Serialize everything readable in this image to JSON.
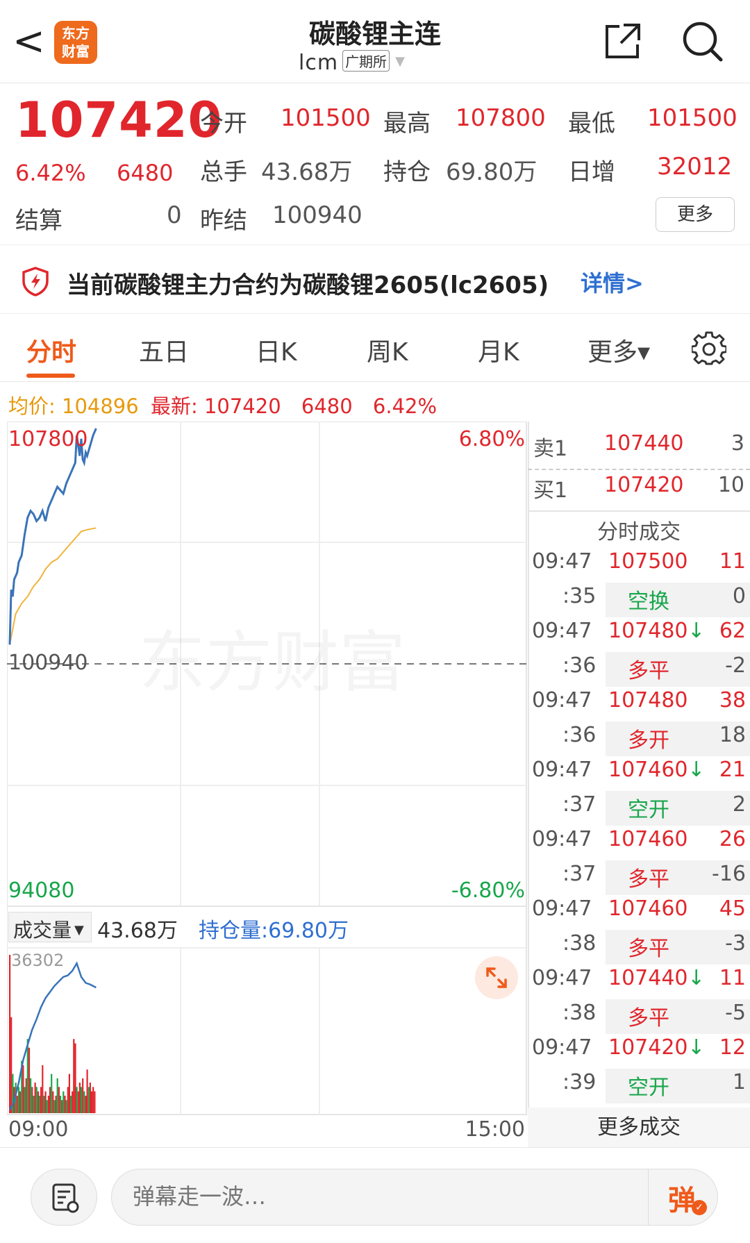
{
  "header": {
    "back": "<",
    "logo_line1": "东方",
    "logo_line2": "财富",
    "title": "碳酸锂主连",
    "code": "lcm",
    "exchange": "广期所"
  },
  "quote": {
    "price": "107420",
    "pct": "6.42%",
    "change": "6480",
    "open_label": "今开",
    "open": "101500",
    "high_label": "最高",
    "high": "107800",
    "low_label": "最低",
    "low": "101500",
    "volume_label": "总手",
    "volume": "43.68万",
    "oi_label": "持仓",
    "oi": "69.80万",
    "daily_inc_label": "日增",
    "daily_inc": "32012",
    "settle_label": "结算",
    "settle": "0",
    "prev_settle_label": "昨结",
    "prev_settle": "100940",
    "more_label": "更多"
  },
  "notice": {
    "text": "当前碳酸锂主力合约为碳酸锂2605(lc2605)",
    "link": "详情>"
  },
  "tabs": [
    "分时",
    "五日",
    "日K",
    "周K",
    "月K",
    "更多▾"
  ],
  "info": {
    "avg_label": "均价:",
    "avg": "104896",
    "latest_label": "最新:",
    "latest": "107420",
    "change": "6480",
    "pct": "6.42%"
  },
  "chart_data": {
    "type": "line",
    "y_top": "107800",
    "y_bottom": "94080",
    "y_ref": "100940",
    "pct_top": "6.80%",
    "pct_bottom": "-6.80%",
    "ylim": [
      94080,
      107800
    ],
    "ref_price": 100940,
    "x_start_label": "09:00",
    "x_end_label": "15:00",
    "total_minutes": 345,
    "price_series": [
      [
        0,
        101500
      ],
      [
        1,
        103100
      ],
      [
        2,
        102900
      ],
      [
        3,
        103400
      ],
      [
        4,
        103500
      ],
      [
        5,
        103600
      ],
      [
        6,
        103900
      ],
      [
        8,
        104100
      ],
      [
        10,
        104700
      ],
      [
        12,
        105200
      ],
      [
        14,
        105400
      ],
      [
        16,
        105300
      ],
      [
        18,
        105100
      ],
      [
        20,
        105200
      ],
      [
        22,
        105400
      ],
      [
        24,
        105100
      ],
      [
        26,
        105500
      ],
      [
        28,
        105700
      ],
      [
        30,
        105900
      ],
      [
        32,
        106100
      ],
      [
        34,
        106000
      ],
      [
        36,
        105900
      ],
      [
        38,
        106200
      ],
      [
        40,
        106400
      ],
      [
        42,
        106600
      ],
      [
        44,
        106800
      ],
      [
        45,
        107600
      ],
      [
        46,
        107300
      ],
      [
        47,
        107000
      ],
      [
        48,
        107500
      ],
      [
        49,
        106900
      ],
      [
        50,
        106800
      ],
      [
        51,
        107100
      ],
      [
        52,
        107000
      ],
      [
        54,
        107300
      ],
      [
        56,
        107600
      ],
      [
        58,
        107800
      ]
    ],
    "avg_series": [
      [
        0,
        101500
      ],
      [
        4,
        102400
      ],
      [
        8,
        102700
      ],
      [
        12,
        102900
      ],
      [
        16,
        103200
      ],
      [
        20,
        103400
      ],
      [
        24,
        103700
      ],
      [
        28,
        103900
      ],
      [
        32,
        104000
      ],
      [
        36,
        104200
      ],
      [
        40,
        104400
      ],
      [
        44,
        104600
      ],
      [
        48,
        104800
      ],
      [
        52,
        104850
      ],
      [
        58,
        104900
      ]
    ],
    "volume": {
      "label": "成交量",
      "value": "43.68万",
      "oi_label": "持仓量:69.80万",
      "max_label": "36302",
      "max": 36302,
      "bars": [
        [
          0,
          36302,
          "red"
        ],
        [
          1,
          22000,
          "red"
        ],
        [
          2,
          9000,
          "green"
        ],
        [
          3,
          6000,
          "red"
        ],
        [
          4,
          7000,
          "green"
        ],
        [
          5,
          4000,
          "red"
        ],
        [
          6,
          6000,
          "green"
        ],
        [
          7,
          5000,
          "red"
        ],
        [
          8,
          12000,
          "green"
        ],
        [
          9,
          11000,
          "red"
        ],
        [
          10,
          6000,
          "green"
        ],
        [
          11,
          8000,
          "red"
        ],
        [
          12,
          17000,
          "green"
        ],
        [
          13,
          15000,
          "red"
        ],
        [
          14,
          8000,
          "green"
        ],
        [
          15,
          6000,
          "red"
        ],
        [
          16,
          4000,
          "green"
        ],
        [
          17,
          7000,
          "red"
        ],
        [
          18,
          6000,
          "green"
        ],
        [
          19,
          5000,
          "red"
        ],
        [
          20,
          4000,
          "green"
        ],
        [
          21,
          6000,
          "red"
        ],
        [
          22,
          11000,
          "red"
        ],
        [
          23,
          4000,
          "green"
        ],
        [
          24,
          5000,
          "red"
        ],
        [
          25,
          3000,
          "green"
        ],
        [
          26,
          4000,
          "red"
        ],
        [
          27,
          6000,
          "red"
        ],
        [
          28,
          9000,
          "green"
        ],
        [
          29,
          5000,
          "red"
        ],
        [
          30,
          3000,
          "green"
        ],
        [
          31,
          4000,
          "red"
        ],
        [
          32,
          8000,
          "green"
        ],
        [
          33,
          6000,
          "red"
        ],
        [
          34,
          4000,
          "green"
        ],
        [
          35,
          3000,
          "red"
        ],
        [
          36,
          5000,
          "green"
        ],
        [
          37,
          4000,
          "red"
        ],
        [
          38,
          3000,
          "green"
        ],
        [
          39,
          6000,
          "red"
        ],
        [
          40,
          9000,
          "red"
        ],
        [
          41,
          4000,
          "green"
        ],
        [
          42,
          5000,
          "red"
        ],
        [
          43,
          17000,
          "red"
        ],
        [
          44,
          16000,
          "red"
        ],
        [
          45,
          6000,
          "green"
        ],
        [
          46,
          5000,
          "red"
        ],
        [
          47,
          7000,
          "red"
        ],
        [
          48,
          6000,
          "green"
        ],
        [
          49,
          8000,
          "red"
        ],
        [
          50,
          5000,
          "green"
        ],
        [
          51,
          4000,
          "red"
        ],
        [
          52,
          10000,
          "red"
        ],
        [
          53,
          6000,
          "green"
        ],
        [
          54,
          7000,
          "red"
        ],
        [
          55,
          5000,
          "red"
        ],
        [
          56,
          6000,
          "red"
        ],
        [
          57,
          5000,
          "red"
        ]
      ],
      "oi_line": [
        [
          0,
          0.02
        ],
        [
          3,
          0.08
        ],
        [
          6,
          0.2
        ],
        [
          9,
          0.35
        ],
        [
          12,
          0.45
        ],
        [
          15,
          0.55
        ],
        [
          18,
          0.62
        ],
        [
          21,
          0.7
        ],
        [
          24,
          0.76
        ],
        [
          27,
          0.8
        ],
        [
          30,
          0.84
        ],
        [
          33,
          0.87
        ],
        [
          36,
          0.9
        ],
        [
          39,
          0.91
        ],
        [
          42,
          0.94
        ],
        [
          45,
          0.99
        ],
        [
          48,
          0.9
        ],
        [
          51,
          0.86
        ],
        [
          54,
          0.85
        ],
        [
          58,
          0.83
        ]
      ]
    }
  },
  "book": {
    "sell_label": "卖1",
    "sell_price": "107440",
    "sell_vol": "3",
    "buy_label": "买1",
    "buy_price": "107420",
    "buy_vol": "10",
    "trades_title": "分时成交",
    "trades": [
      {
        "time": "09:47",
        "price": "107500",
        "arrow": "",
        "vol": "11",
        "sec": ":35",
        "type": "空换",
        "tcolor": "green",
        "delta": "0"
      },
      {
        "time": "09:47",
        "price": "107480",
        "arrow": "↓",
        "vol": "62",
        "sec": ":36",
        "type": "多平",
        "tcolor": "red",
        "delta": "-2"
      },
      {
        "time": "09:47",
        "price": "107480",
        "arrow": "",
        "vol": "38",
        "sec": ":36",
        "type": "多开",
        "tcolor": "red",
        "delta": "18"
      },
      {
        "time": "09:47",
        "price": "107460",
        "arrow": "↓",
        "vol": "21",
        "sec": ":37",
        "type": "空开",
        "tcolor": "green",
        "delta": "2"
      },
      {
        "time": "09:47",
        "price": "107460",
        "arrow": "",
        "vol": "26",
        "sec": ":37",
        "type": "多平",
        "tcolor": "red",
        "delta": "-16"
      },
      {
        "time": "09:47",
        "price": "107460",
        "arrow": "",
        "vol": "45",
        "sec": ":38",
        "type": "多平",
        "tcolor": "red",
        "delta": "-3"
      },
      {
        "time": "09:47",
        "price": "107440",
        "arrow": "↓",
        "vol": "11",
        "sec": ":38",
        "type": "多平",
        "tcolor": "red",
        "delta": "-5"
      },
      {
        "time": "09:47",
        "price": "107420",
        "arrow": "↓",
        "vol": "12",
        "sec": ":39",
        "type": "空开",
        "tcolor": "green",
        "delta": "1"
      }
    ],
    "more_trades": "更多成交"
  },
  "bottom": {
    "placeholder": "弹幕走一波…",
    "danmu_btn": "弹"
  },
  "colors": {
    "red": "#e0262c",
    "green": "#18a64b",
    "accent": "#ef5a1a",
    "blue": "#2f6fd1",
    "avg_line": "#f0b43c",
    "price_line": "#3a73b8"
  }
}
